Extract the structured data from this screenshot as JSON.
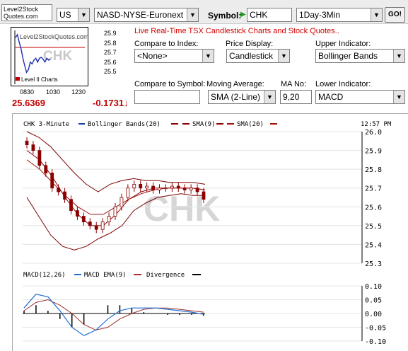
{
  "logo": {
    "line1": "Level2Stock",
    "line2": "Quotes.com"
  },
  "toolbar": {
    "country": "US",
    "exchange": "NASD-NYSE-Euronext",
    "symbol_label": "Symbol:",
    "symbol_value": "CHK",
    "period": "1Day-3Min",
    "go_label": "GO!"
  },
  "mini_chart": {
    "watermark_site": "Level2StockQuotes.com",
    "watermark_symbol": "CHK",
    "footer": "Level II Charts",
    "y_ticks": [
      "25.9",
      "25.8",
      "25.7",
      "25.6",
      "25.5"
    ],
    "x_ticks": [
      "0830",
      "1030",
      "1230"
    ],
    "price": "25.6369",
    "change": "-0.1731"
  },
  "panel": {
    "title": "Live Real-Time TSX Candlestick Charts and Stock Quotes..",
    "compare_index_label": "Compare to Index:",
    "compare_index_value": "<None>",
    "price_display_label": "Price Display:",
    "price_display_value": "Candlestick",
    "upper_indicator_label": "Upper Indicator:",
    "upper_indicator_value": "Bollinger Bands",
    "compare_symbol_label": "Compare to Symbol:",
    "compare_symbol_value": "",
    "moving_average_label": "Moving Average:",
    "moving_average_value": "SMA (2-Line)",
    "ma_no_label": "MA No:",
    "ma_no_value": "9,20",
    "lower_indicator_label": "Lower Indicator:",
    "lower_indicator_value": "MACD"
  },
  "chart_legend": {
    "symbol": "CHK 3-Minute",
    "bb": "Bollinger Bands(20)",
    "sma1": "SMA(9)",
    "sma2": "SMA(20)",
    "time": "12:57 PM"
  },
  "macd_legend": {
    "macd": "MACD(12,26)",
    "ema": "MACD EMA(9)",
    "div": "Divergence"
  },
  "colors": {
    "candle": "#8b0000",
    "bollinger": "#7a0000",
    "sma9": "#8b0000",
    "sma20": "#a01010",
    "macd": "#1f6fd0",
    "macd_ema": "#a03030",
    "divergence": "#000000",
    "title_red": "#d00000"
  },
  "chart_data": [
    {
      "type": "line",
      "title": "CHK 3-Minute",
      "y_ticks": [
        "26.0",
        "25.9",
        "25.8",
        "25.7",
        "25.6",
        "25.5",
        "25.4",
        "25.3"
      ],
      "ylim": [
        25.3,
        26.0
      ],
      "series": [
        {
          "name": "Close (candles)",
          "values": [
            25.93,
            25.9,
            25.82,
            25.78,
            25.7,
            25.68,
            25.64,
            25.58,
            25.55,
            25.52,
            25.5,
            25.48,
            25.52,
            25.55,
            25.6,
            25.65,
            25.7,
            25.72,
            25.7,
            25.71,
            25.69,
            25.7,
            25.7,
            25.71,
            25.7,
            25.69,
            25.7,
            25.68,
            25.64
          ]
        },
        {
          "name": "Bollinger Bands(20) upper",
          "values": [
            26.0,
            25.97,
            25.92,
            25.85,
            25.78,
            25.72,
            25.68,
            25.72,
            25.74,
            25.75,
            25.74,
            25.74,
            25.73,
            25.73,
            25.73,
            25.72
          ]
        },
        {
          "name": "Bollinger Bands(20) lower",
          "values": [
            25.65,
            25.55,
            25.45,
            25.39,
            25.37,
            25.39,
            25.43,
            25.46,
            25.5,
            25.58,
            25.62,
            25.65,
            25.66,
            25.67,
            25.66,
            25.66
          ]
        },
        {
          "name": "SMA(9)",
          "values": [
            25.9,
            25.85,
            25.76,
            25.65,
            25.56,
            25.5,
            25.5,
            25.56,
            25.64,
            25.68,
            25.7,
            25.7,
            25.7,
            25.7,
            25.69
          ]
        },
        {
          "name": "SMA(20)",
          "values": [
            25.85,
            25.8,
            25.73,
            25.66,
            25.6,
            25.56,
            25.56,
            25.6,
            25.64,
            25.67,
            25.69,
            25.7,
            25.7,
            25.7,
            25.69
          ]
        }
      ]
    },
    {
      "type": "line",
      "title": "MACD(12,26)",
      "y_ticks": [
        "0.10",
        "0.05",
        "0.00",
        "-0.05",
        "-0.10"
      ],
      "ylim": [
        -0.1,
        0.1
      ],
      "series": [
        {
          "name": "MACD(12,26)",
          "values": [
            0.02,
            0.07,
            0.06,
            0.01,
            -0.05,
            -0.08,
            -0.06,
            -0.02,
            0.01,
            0.02,
            0.02,
            0.02,
            0.015,
            0.01,
            0.005,
            -0.003
          ]
        },
        {
          "name": "MACD EMA(9)",
          "values": [
            0.01,
            0.04,
            0.05,
            0.03,
            0.0,
            -0.04,
            -0.06,
            -0.05,
            -0.02,
            0.0,
            0.015,
            0.02,
            0.02,
            0.015,
            0.01,
            0.005
          ]
        }
      ]
    }
  ]
}
